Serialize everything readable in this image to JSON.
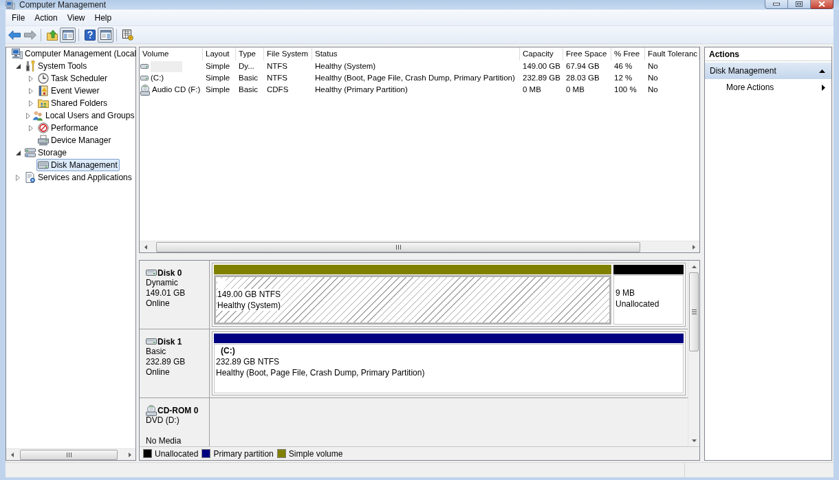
{
  "window": {
    "title": "Computer Management"
  },
  "menu": [
    "File",
    "Action",
    "View",
    "Help"
  ],
  "toolbar": [
    {
      "kind": "back",
      "disabled": false,
      "pressed": false
    },
    {
      "kind": "forward",
      "disabled": true,
      "pressed": false
    },
    {
      "kind": "separator"
    },
    {
      "kind": "up",
      "disabled": false,
      "pressed": false
    },
    {
      "kind": "console-tree",
      "disabled": false,
      "pressed": true
    },
    {
      "kind": "separator"
    },
    {
      "kind": "help",
      "disabled": false,
      "pressed": false
    },
    {
      "kind": "action-pane",
      "disabled": false,
      "pressed": true
    },
    {
      "kind": "separator"
    },
    {
      "kind": "properties",
      "disabled": false,
      "pressed": false
    }
  ],
  "tree": [
    {
      "label": "Computer Management (Local",
      "kind": "computer",
      "expandable": false,
      "selected": false,
      "children": [
        {
          "label": "System Tools",
          "kind": "tools",
          "expandable": true,
          "expanded": true,
          "selected": false,
          "children": [
            {
              "label": "Task Scheduler",
              "kind": "scheduler",
              "expandable": true,
              "expanded": false,
              "selected": false
            },
            {
              "label": "Event Viewer",
              "kind": "event-log",
              "expandable": true,
              "expanded": false,
              "selected": false
            },
            {
              "label": "Shared Folders",
              "kind": "shared-folder",
              "expandable": true,
              "expanded": false,
              "selected": false
            },
            {
              "label": "Local Users and Groups",
              "kind": "users",
              "expandable": true,
              "expanded": false,
              "selected": false
            },
            {
              "label": "Performance",
              "kind": "performance",
              "expandable": true,
              "expanded": false,
              "selected": false
            },
            {
              "label": "Device Manager",
              "kind": "device-manager",
              "expandable": false,
              "selected": false
            }
          ]
        },
        {
          "label": "Storage",
          "kind": "storage",
          "expandable": true,
          "expanded": true,
          "selected": false,
          "children": [
            {
              "label": "Disk Management",
              "kind": "disk-management",
              "expandable": false,
              "selected": true
            }
          ]
        },
        {
          "label": "Services and Applications",
          "kind": "services",
          "expandable": true,
          "expanded": false,
          "selected": false
        }
      ]
    }
  ],
  "volume_table": {
    "columns": [
      "Volume",
      "Layout",
      "Type",
      "File System",
      "Status",
      "Capacity",
      "Free Space",
      "% Free",
      "Fault Toleranc"
    ],
    "rows": [
      {
        "kind": "drive",
        "redacted": true,
        "cells": [
          "",
          "Simple",
          "Dy...",
          "NTFS",
          "Healthy (System)",
          "149.00 GB",
          "67.94 GB",
          "46 %",
          "No"
        ]
      },
      {
        "kind": "drive",
        "redacted": false,
        "cells": [
          "(C:)",
          "Simple",
          "Basic",
          "NTFS",
          "Healthy (Boot, Page File, Crash Dump, Primary Partition)",
          "232.89 GB",
          "28.03 GB",
          "12 %",
          "No"
        ]
      },
      {
        "kind": "cd",
        "redacted": false,
        "cells": [
          "Audio CD (F:)",
          "Simple",
          "Basic",
          "CDFS",
          "Healthy (Primary Partition)",
          "0 MB",
          "0 MB",
          "100 %",
          "No"
        ]
      }
    ]
  },
  "disks": [
    {
      "kind": "disk",
      "name": "Disk 0",
      "type": "Dynamic",
      "size": "149.01 GB",
      "status": "Online",
      "partitions": [
        {
          "kind": "volume",
          "color": "#808000",
          "hatched": true,
          "selected": true,
          "redacted": true,
          "lines": [
            "149.00 GB NTFS",
            "Healthy (System)"
          ]
        },
        {
          "kind": "unallocated",
          "color": "#000000",
          "hatched": false,
          "selected": false,
          "redacted": false,
          "lines": [
            "9 MB",
            "Unallocated"
          ]
        }
      ]
    },
    {
      "kind": "disk",
      "name": "Disk 1",
      "type": "Basic",
      "size": "232.89 GB",
      "status": "Online",
      "partitions": [
        {
          "kind": "volume",
          "color": "#000080",
          "hatched": false,
          "selected": false,
          "redacted": false,
          "name": "(C:)",
          "lines": [
            "232.89 GB NTFS",
            "Healthy (Boot, Page File, Crash Dump, Primary Partition)"
          ]
        }
      ]
    },
    {
      "kind": "cdrom",
      "name": "CD-ROM 0",
      "type": "DVD (D:)",
      "status": "No Media"
    }
  ],
  "legend": [
    {
      "label": "Unallocated",
      "color": "#000000"
    },
    {
      "label": "Primary partition",
      "color": "#000080"
    },
    {
      "label": "Simple volume",
      "color": "#808000"
    }
  ],
  "actions": {
    "title": "Actions",
    "sections": [
      {
        "label": "Disk Management",
        "expanded": true,
        "items": [
          {
            "label": "More Actions",
            "submenu": true
          }
        ]
      }
    ]
  }
}
